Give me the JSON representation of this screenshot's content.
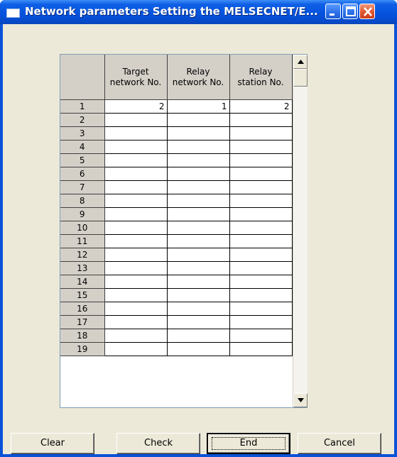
{
  "window": {
    "title": "Network parameters  Setting the MELSECNET/E..."
  },
  "titlebar_buttons": {
    "minimize": "minimize-icon",
    "maximize": "maximize-icon",
    "close": "close-icon"
  },
  "grid": {
    "columns": [
      "Target network No.",
      "Relay network No.",
      "Relay station No."
    ],
    "column_lines": [
      [
        "Target",
        "network No."
      ],
      [
        "Relay",
        "network No."
      ],
      [
        "Relay",
        "station No."
      ]
    ],
    "rows": [
      {
        "no": "1",
        "target": "2",
        "relay_network": "1",
        "relay_station": "2"
      },
      {
        "no": "2",
        "target": "",
        "relay_network": "",
        "relay_station": ""
      },
      {
        "no": "3",
        "target": "",
        "relay_network": "",
        "relay_station": ""
      },
      {
        "no": "4",
        "target": "",
        "relay_network": "",
        "relay_station": ""
      },
      {
        "no": "5",
        "target": "",
        "relay_network": "",
        "relay_station": ""
      },
      {
        "no": "6",
        "target": "",
        "relay_network": "",
        "relay_station": ""
      },
      {
        "no": "7",
        "target": "",
        "relay_network": "",
        "relay_station": ""
      },
      {
        "no": "8",
        "target": "",
        "relay_network": "",
        "relay_station": ""
      },
      {
        "no": "9",
        "target": "",
        "relay_network": "",
        "relay_station": ""
      },
      {
        "no": "10",
        "target": "",
        "relay_network": "",
        "relay_station": ""
      },
      {
        "no": "11",
        "target": "",
        "relay_network": "",
        "relay_station": ""
      },
      {
        "no": "12",
        "target": "",
        "relay_network": "",
        "relay_station": ""
      },
      {
        "no": "13",
        "target": "",
        "relay_network": "",
        "relay_station": ""
      },
      {
        "no": "14",
        "target": "",
        "relay_network": "",
        "relay_station": ""
      },
      {
        "no": "15",
        "target": "",
        "relay_network": "",
        "relay_station": ""
      },
      {
        "no": "16",
        "target": "",
        "relay_network": "",
        "relay_station": ""
      },
      {
        "no": "17",
        "target": "",
        "relay_network": "",
        "relay_station": ""
      },
      {
        "no": "18",
        "target": "",
        "relay_network": "",
        "relay_station": ""
      },
      {
        "no": "19",
        "target": "",
        "relay_network": "",
        "relay_station": ""
      }
    ]
  },
  "scrollbar": {
    "up_icon": "scroll-up-icon",
    "down_icon": "scroll-down-icon"
  },
  "buttons": {
    "clear": "Clear",
    "check": "Check",
    "end": "End",
    "cancel": "Cancel"
  },
  "colors": {
    "titlebar": "#0553de",
    "face": "#ece9d8",
    "header": "#d4d0c8"
  }
}
